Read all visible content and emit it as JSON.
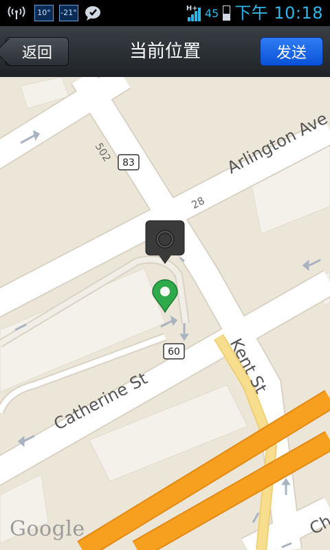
{
  "status_bar": {
    "time": "下午 10:18",
    "battery_level": "45",
    "network_type": "H+",
    "temp_1": "10°",
    "temp_2": "-21°",
    "icons": [
      "signal-broadcast-icon",
      "temperature-icon",
      "temperature-icon",
      "chat-icon",
      "network-signal-icon",
      "battery-icon"
    ]
  },
  "title_bar": {
    "back_label": "返回",
    "title": "当前位置",
    "send_label": "发送"
  },
  "map": {
    "streets": [
      "Arlington Ave",
      "Catherine St",
      "Kent St",
      "Ch"
    ],
    "route_shields": [
      "83",
      "60"
    ],
    "address_numbers": [
      "502",
      "28"
    ],
    "logo": "Google",
    "colors": {
      "land": "#ece6d9",
      "block": "#f4f1ea",
      "road": "#ffffff",
      "highway": "#f79f1f",
      "secondary": "#f7dd8e",
      "route_outline": "#c9c2b6"
    }
  }
}
